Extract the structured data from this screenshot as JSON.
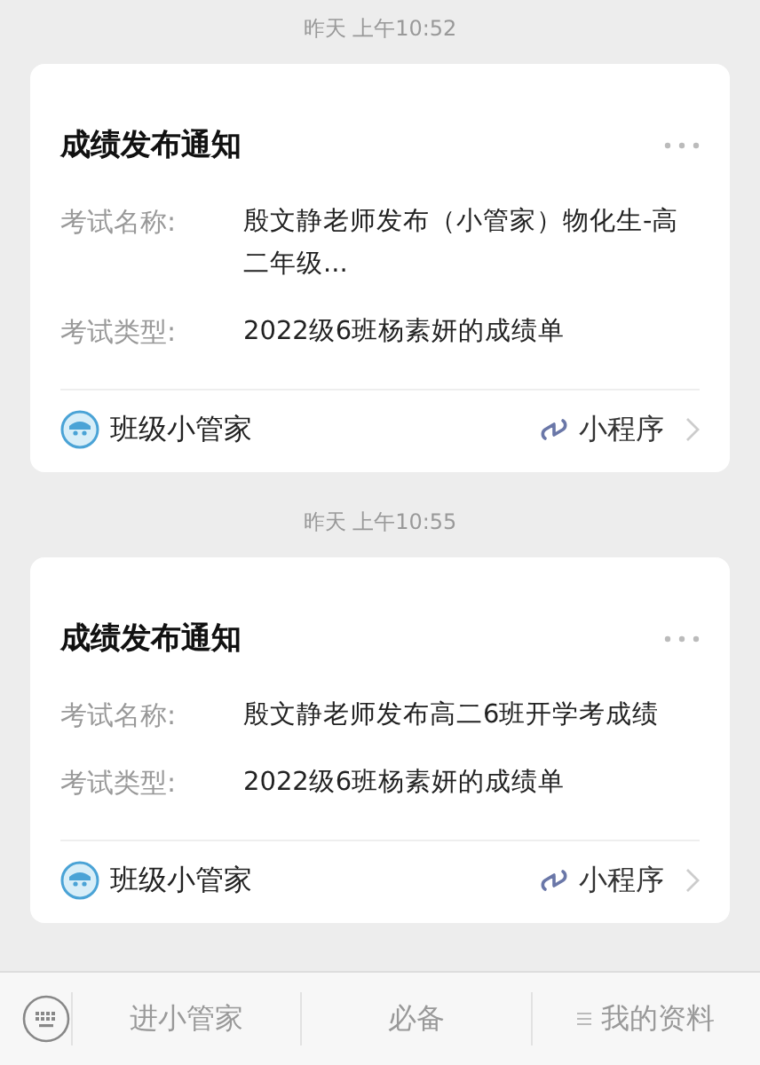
{
  "messages": [
    {
      "time": "昨天 上午10:52",
      "title": "成绩发布通知",
      "fields": [
        {
          "label": "考试名称:",
          "value": "殷文静老师发布（小管家）物化生-高二年级..."
        },
        {
          "label": "考试类型:",
          "value": "2022级6班杨素妍的成绩单"
        }
      ],
      "source": "班级小管家",
      "source_type": "小程序"
    },
    {
      "time": "昨天 上午10:55",
      "title": "成绩发布通知",
      "fields": [
        {
          "label": "考试名称:",
          "value": "殷文静老师发布高二6班开学考成绩"
        },
        {
          "label": "考试类型:",
          "value": "2022级6班杨素妍的成绩单"
        }
      ],
      "source": "班级小管家",
      "source_type": "小程序"
    }
  ],
  "menu": [
    {
      "label": "进小管家",
      "kind": "plain"
    },
    {
      "label": "必备",
      "kind": "plain"
    },
    {
      "label": "我的资料",
      "kind": "list"
    }
  ]
}
